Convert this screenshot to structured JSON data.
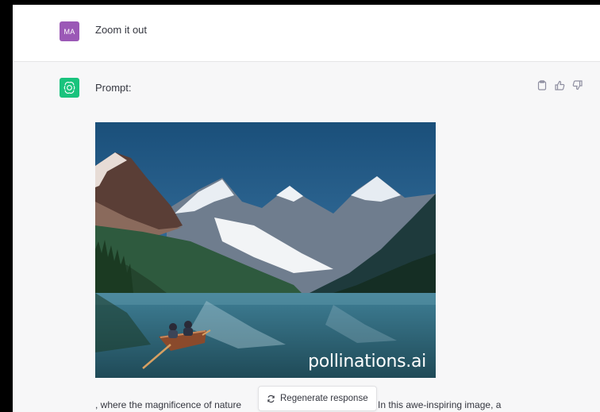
{
  "user_message": {
    "avatar_initials": "MA",
    "text": "Zoom it out",
    "avatar_color": "#9b59b6"
  },
  "assistant_message": {
    "label": "Prompt:",
    "avatar_icon": "openai-logo-icon",
    "avatar_color": "#19c37d",
    "image": {
      "description": "Mountain lake landscape with two people in a rowboat",
      "watermark": "pollinations.ai"
    },
    "text_before_button": ", where the magnificence of nature",
    "text_after_button": "In this awe-inspiring image, a",
    "actions": [
      "copy-icon",
      "thumbs-up-icon",
      "thumbs-down-icon"
    ]
  },
  "regenerate_button": {
    "label": "Regenerate response",
    "icon": "refresh-icon"
  }
}
